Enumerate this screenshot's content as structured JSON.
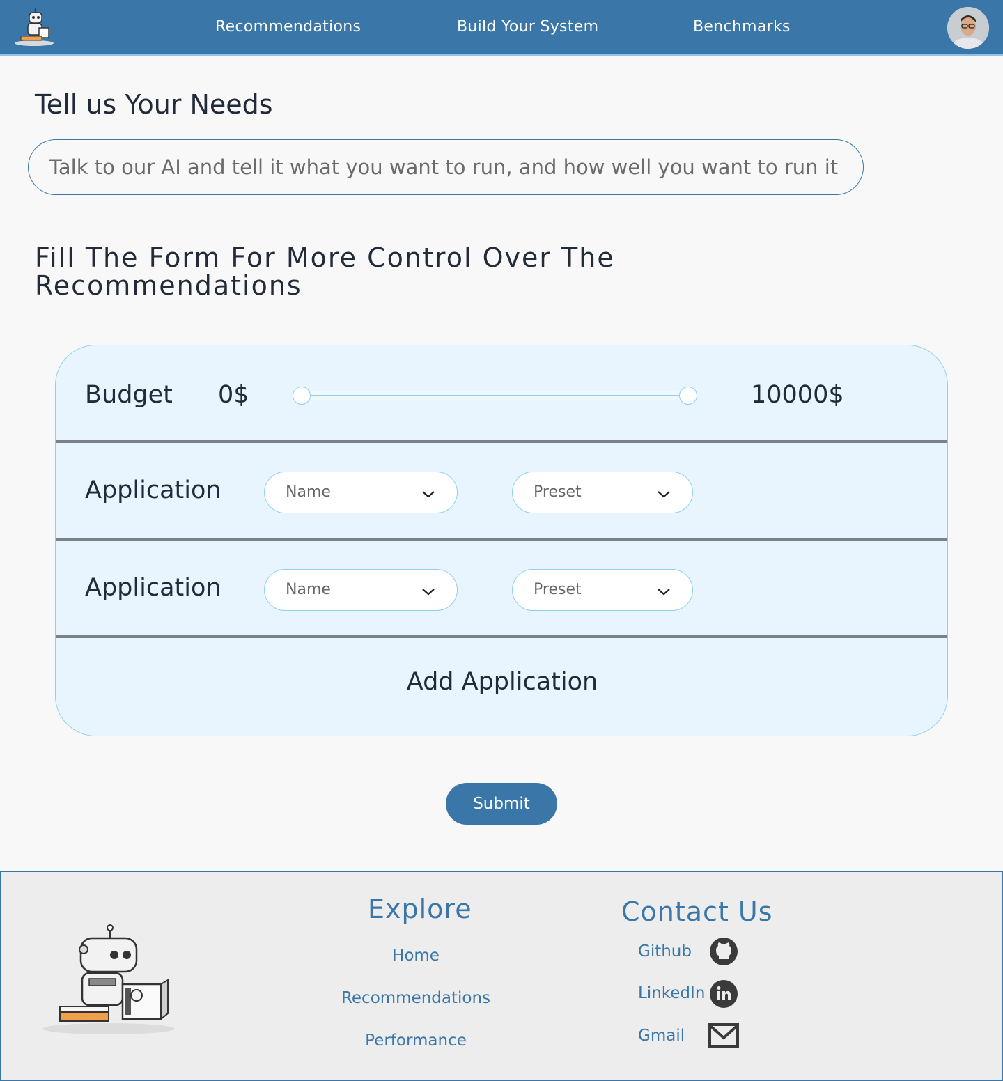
{
  "nav": {
    "links": [
      "Recommendations",
      "Build Your System",
      "Benchmarks"
    ]
  },
  "needs": {
    "title": "Tell us Your Needs",
    "placeholder": "Talk to our AI and tell it what you want to run, and how well you want to run it"
  },
  "form": {
    "title": "Fill The Form For More Control Over The Recommendations",
    "budget": {
      "label": "Budget",
      "min_label": "0$",
      "max_label": "10000$",
      "min_value": 0,
      "max_value": 10000
    },
    "applications": [
      {
        "label": "Application",
        "name_placeholder": "Name",
        "preset_placeholder": "Preset"
      },
      {
        "label": "Application",
        "name_placeholder": "Name",
        "preset_placeholder": "Preset"
      }
    ],
    "add_label": "Add Application",
    "submit_label": "Submit"
  },
  "footer": {
    "explore_title": "Explore",
    "explore_links": [
      "Home",
      "Recommendations",
      "Performance"
    ],
    "contact_title": "Contact Us",
    "contacts": [
      {
        "label": "Github",
        "icon": "github-icon"
      },
      {
        "label": "LinkedIn",
        "icon": "linkedin-icon"
      },
      {
        "label": "Gmail",
        "icon": "mail-icon"
      }
    ]
  },
  "colors": {
    "brand": "#3a76a8",
    "card_bg": "#e8f5fe",
    "card_border": "#8fd0ea"
  }
}
